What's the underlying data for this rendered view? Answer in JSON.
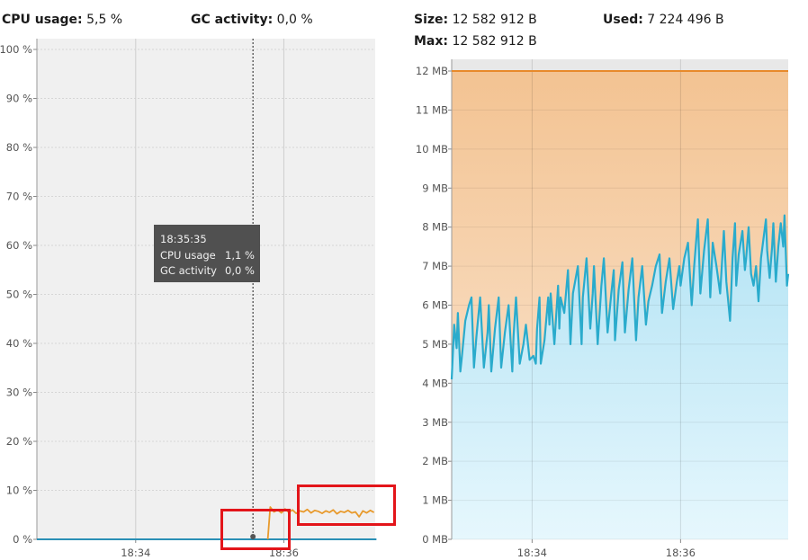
{
  "cpu_panel": {
    "cpu_label": "CPU usage:",
    "cpu_value": "5,5 %",
    "gc_label": "GC activity:",
    "gc_value": "0,0 %",
    "tooltip": {
      "time": "18:35:35",
      "rows": [
        {
          "label": "CPU usage",
          "value": "1,1 %"
        },
        {
          "label": "GC activity",
          "value": "0,0 %"
        }
      ]
    }
  },
  "heap_panel": {
    "size_label": "Size:",
    "size_value": "12 582 912 B",
    "used_label": "Used:",
    "used_value": "7 224 496 B",
    "max_label": "Max:",
    "max_value": "12 582 912 B"
  },
  "colors": {
    "plot_bg": "#f0f0f0",
    "cpu_line": "#e89a2c",
    "gc_line": "#2a8fb5",
    "heap_size_line": "#e88a2a",
    "heap_used_line": "#2aabcc",
    "highlight_box": "#e3151a",
    "tooltip_bg": "#505050"
  },
  "chart_data": [
    {
      "type": "line",
      "title": "",
      "ylabel": "",
      "xlabel": "",
      "ylim": [
        0,
        100
      ],
      "y_ticks": [
        "0 %",
        "10 %",
        "20 %",
        "30 %",
        "40 %",
        "50 %",
        "60 %",
        "70 %",
        "80 %",
        "90 %",
        "100 %"
      ],
      "x_ticks": [
        "18:34",
        "18:36"
      ],
      "grid": true,
      "series": [
        {
          "name": "CPU usage",
          "x": [
            "18:35:47",
            "18:35:49",
            "18:35:52",
            "18:35:55",
            "18:35:58",
            "18:36:01",
            "18:36:04",
            "18:36:07",
            "18:36:10",
            "18:36:13",
            "18:36:16",
            "18:36:19",
            "18:36:22",
            "18:36:25",
            "18:36:28",
            "18:36:31",
            "18:36:34",
            "18:36:37",
            "18:36:40",
            "18:36:43",
            "18:36:46",
            "18:36:49",
            "18:36:52",
            "18:36:55",
            "18:36:58",
            "18:37:01",
            "18:37:04",
            "18:37:07",
            "18:37:10",
            "18:37:13"
          ],
          "values": [
            0,
            6.6,
            5.6,
            6.0,
            5.4,
            6.2,
            5.5,
            6.0,
            5.3,
            5.8,
            5.6,
            6.1,
            5.4,
            5.9,
            5.7,
            5.3,
            5.8,
            5.5,
            6.0,
            5.2,
            5.7,
            5.5,
            5.9,
            5.4,
            5.6,
            4.6,
            5.8,
            5.4,
            5.9,
            5.5
          ]
        },
        {
          "name": "GC activity",
          "x": [
            "18:32:40",
            "18:37:15"
          ],
          "values": [
            0.0,
            0.0
          ]
        }
      ],
      "cursor": {
        "x": "18:35:35",
        "value": 1.1
      }
    },
    {
      "type": "area",
      "title": "",
      "ylim": [
        0,
        12
      ],
      "y_ticks": [
        "0 MB",
        "1 MB",
        "2 MB",
        "3 MB",
        "4 MB",
        "5 MB",
        "6 MB",
        "7 MB",
        "8 MB",
        "9 MB",
        "10 MB",
        "11 MB",
        "12 MB"
      ],
      "x_ticks": [
        "18:34",
        "18:36"
      ],
      "grid": true,
      "series": [
        {
          "name": "Size",
          "x": [
            "18:32:55",
            "18:37:27"
          ],
          "values": [
            12,
            12
          ]
        },
        {
          "name": "Used",
          "x": [
            "18:32:55",
            "18:32:57",
            "18:32:59",
            "18:33:00",
            "18:33:02",
            "18:33:03",
            "18:33:06",
            "18:33:09",
            "18:33:11",
            "18:33:13",
            "18:33:15",
            "18:33:18",
            "18:33:21",
            "18:33:24",
            "18:33:25",
            "18:33:27",
            "18:33:30",
            "18:33:33",
            "18:33:35",
            "18:33:38",
            "18:33:41",
            "18:33:44",
            "18:33:45",
            "18:33:47",
            "18:33:50",
            "18:33:53",
            "18:33:55",
            "18:33:58",
            "18:34:01",
            "18:34:03",
            "18:34:04",
            "18:34:05",
            "18:34:06",
            "18:34:07",
            "18:34:10",
            "18:34:13",
            "18:34:14",
            "18:34:15",
            "18:34:18",
            "18:34:21",
            "18:34:22",
            "18:34:23",
            "18:34:26",
            "18:34:29",
            "18:34:31",
            "18:34:33",
            "18:34:37",
            "18:34:40",
            "18:34:41",
            "18:34:44",
            "18:34:47",
            "18:34:49",
            "18:34:50",
            "18:34:53",
            "18:34:56",
            "18:34:58",
            "18:35:01",
            "18:35:04",
            "18:35:06",
            "18:35:07",
            "18:35:10",
            "18:35:13",
            "18:35:15",
            "18:35:18",
            "18:35:21",
            "18:35:24",
            "18:35:26",
            "18:35:29",
            "18:35:32",
            "18:35:34",
            "18:35:37",
            "18:35:40",
            "18:35:43",
            "18:35:45",
            "18:35:48",
            "18:35:51",
            "18:35:54",
            "18:35:57",
            "18:35:59",
            "18:36:00",
            "18:36:03",
            "18:36:06",
            "18:36:09",
            "18:36:11",
            "18:36:13",
            "18:36:14",
            "18:36:16",
            "18:36:19",
            "18:36:22",
            "18:36:24",
            "18:36:26",
            "18:36:29",
            "18:36:32",
            "18:36:35",
            "18:36:37",
            "18:36:40",
            "18:36:42",
            "18:36:44",
            "18:36:45",
            "18:36:47",
            "18:36:50",
            "18:36:52",
            "18:36:53",
            "18:36:55",
            "18:36:57",
            "18:36:59",
            "18:37:01",
            "18:37:03",
            "18:37:05",
            "18:37:07",
            "18:37:09",
            "18:37:10",
            "18:37:12",
            "18:37:14",
            "18:37:15",
            "18:37:17",
            "18:37:19",
            "18:37:21",
            "18:37:23",
            "18:37:24",
            "18:37:26",
            "18:37:27"
          ],
          "values": [
            4.1,
            5.5,
            4.9,
            5.8,
            4.3,
            4.6,
            5.6,
            6.0,
            6.2,
            4.4,
            5.2,
            6.2,
            4.4,
            5.3,
            6.0,
            4.3,
            5.4,
            6.2,
            4.4,
            5.3,
            6.0,
            4.3,
            5.2,
            6.2,
            4.5,
            5.0,
            5.5,
            4.6,
            4.7,
            4.5,
            5.4,
            5.8,
            6.2,
            4.5,
            5.1,
            6.2,
            5.5,
            6.3,
            5.0,
            6.5,
            5.4,
            6.2,
            5.8,
            6.9,
            5.0,
            6.3,
            7.0,
            5.0,
            6.2,
            7.2,
            5.4,
            6.3,
            7.0,
            5.0,
            6.5,
            7.2,
            5.3,
            6.3,
            6.9,
            5.1,
            6.4,
            7.1,
            5.3,
            6.4,
            7.2,
            5.1,
            6.2,
            7.0,
            5.5,
            6.1,
            6.5,
            7.0,
            7.3,
            5.8,
            6.6,
            7.2,
            5.9,
            6.6,
            7.0,
            6.5,
            7.2,
            7.6,
            6.0,
            7.0,
            7.8,
            8.2,
            6.3,
            7.4,
            8.2,
            6.2,
            7.6,
            7.0,
            6.3,
            7.9,
            6.6,
            5.6,
            7.2,
            8.1,
            6.5,
            7.3,
            7.9,
            6.9,
            7.2,
            8.0,
            6.8,
            6.5,
            7.0,
            6.1,
            7.2,
            7.7,
            8.2,
            7.4,
            6.7,
            7.5,
            8.1,
            6.6,
            7.5,
            8.1,
            7.5,
            8.3,
            6.5,
            6.8
          ]
        }
      ]
    }
  ]
}
